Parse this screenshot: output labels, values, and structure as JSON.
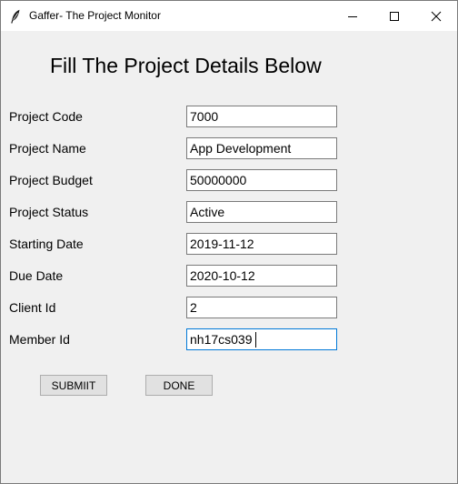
{
  "window": {
    "title": "Gaffer- The Project Monitor",
    "controls": {
      "minimize_icon": "minimize-icon",
      "maximize_icon": "maximize-icon",
      "close_icon": "close-icon"
    }
  },
  "form": {
    "heading": "Fill The Project Details Below",
    "fields": [
      {
        "label": "Project Code",
        "value": "7000"
      },
      {
        "label": "Project Name",
        "value": "App Development"
      },
      {
        "label": "Project Budget",
        "value": "50000000"
      },
      {
        "label": "Project Status",
        "value": "Active"
      },
      {
        "label": "Starting Date",
        "value": "2019-11-12"
      },
      {
        "label": "Due Date",
        "value": "2020-10-12"
      },
      {
        "label": "Client Id",
        "value": "2"
      },
      {
        "label": "Member Id",
        "value": "nh17cs039"
      }
    ],
    "buttons": {
      "submit_label": "SUBMIIT",
      "done_label": "DONE"
    }
  },
  "colors": {
    "window_bg": "#f0f0f0",
    "titlebar_bg": "#ffffff",
    "focus_border": "#0078d7",
    "button_bg": "#e1e1e1"
  }
}
